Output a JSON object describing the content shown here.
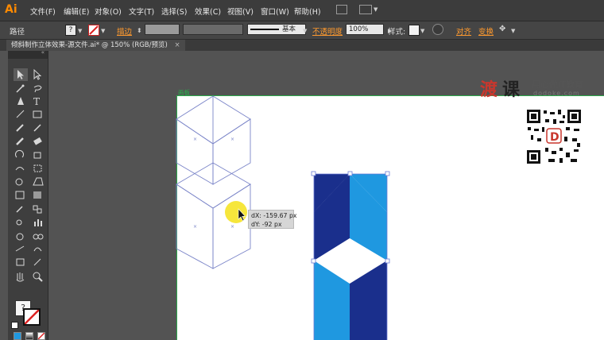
{
  "app": {
    "logo": "Ai"
  },
  "menu": [
    "文件(F)",
    "编辑(E)",
    "对象(O)",
    "文字(T)",
    "选择(S)",
    "效果(C)",
    "视图(V)",
    "窗口(W)",
    "帮助(H)"
  ],
  "control_bar": {
    "selection_label": "路径",
    "stroke_label": "描边",
    "stroke_style": "基本",
    "opacity_label": "不透明度",
    "opacity_value": "100%",
    "style_label": "样式:",
    "align_label": "对齐",
    "transform_label": "变换"
  },
  "document_tab": {
    "title": "倾斜制作立体效果-源文件.ai* @ 150% (RGB/预览)",
    "close": "×"
  },
  "canvas": {
    "artboard_name": "画板",
    "move_tooltip": {
      "dx": "dX: -159.67 px",
      "dy": "dY: -92 px"
    }
  },
  "watermark": {
    "brand_a": "渡",
    "brand_b": "课",
    "slogan": "用心做IT教育",
    "site": "dodoke.com"
  },
  "colors": {
    "dark_blue": "#1a2f8c",
    "light_blue": "#1f98e0",
    "accent": "#ff8a00",
    "artboard_border": "#2aa84a"
  }
}
